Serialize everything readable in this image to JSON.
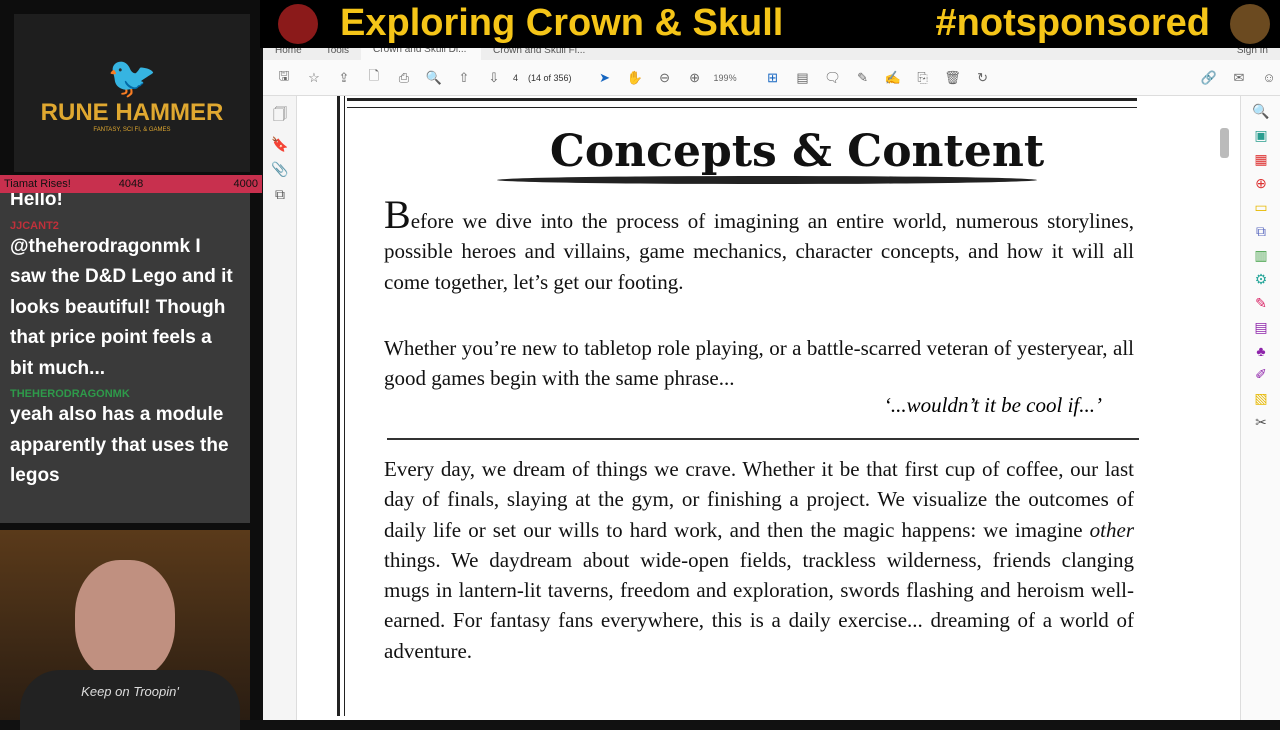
{
  "stream": {
    "title": "Exploring Crown & Skull",
    "tag": "#notsponsored",
    "logo_text": "RUNE HAMMER",
    "logo_sub": "FANTASY, SCI FI, & GAMES",
    "goal": {
      "label": "Tiamat Rises!",
      "current": "4048",
      "target": "4000"
    },
    "chat": [
      {
        "user": "",
        "text": "Hello!"
      },
      {
        "user": "JJCANT2",
        "user_color": "#c0303a",
        "text": "@theherodragonmk I saw the D&D Lego and it looks beautiful! Though that price point feels a bit much..."
      },
      {
        "user": "THEHERODRAGONMK",
        "user_color": "#2e9a4a",
        "text": "yeah also has a module apparently that uses the legos"
      }
    ],
    "webcam_shirt": "Keep on Troopin'"
  },
  "viewer": {
    "tabs": [
      "Home",
      "Tools",
      "Crown and Skull Di...",
      "Crown and Skull Fi..."
    ],
    "signin": "Sign In",
    "page_input": "4",
    "page_count": "(14 of 356)",
    "zoom": "199%",
    "toolbar_icons": [
      "save-icon",
      "star-icon",
      "upload-icon",
      "document-icon",
      "print-icon",
      "zoom-out-icon",
      "page-up-icon",
      "page-down-icon",
      "select-icon",
      "hand-icon",
      "minus-icon",
      "plus-icon",
      "fit-icon",
      "ruler-icon",
      "comment-icon",
      "pen-icon",
      "sign-icon",
      "stamp-icon",
      "trash-icon",
      "rotate-icon",
      "share-icon",
      "mail-icon",
      "user-icon"
    ]
  },
  "document": {
    "title": "Concepts & Content",
    "p1_dropcap": "B",
    "p1": "efore we dive into the process of imagining an entire world, numerous storylines, possible heroes and villains, game mechanics, character concepts, and how it will all come together, let’s get our footing.",
    "p2": "Whether you’re new to tabletop role playing, or a battle-scarred veteran of yesteryear, all good games begin with the same phrase...",
    "quote": "‘...wouldn’t it be cool if...’",
    "p3a": "Every day, we dream of things we crave. Whether it be that first cup of coffee, our last day of finals, slaying at the gym, or finishing a project. We visualize the outcomes of daily life or set our wills to hard work, and then the magic happens: we imagine ",
    "p3em": "other",
    "p3b": " things. We daydream about wide-open fields, trackless wilderness, friends clanging mugs in lantern-lit taverns, freedom and exploration, swords flashing and heroism well-earned. For fantasy fans everywhere, this is a daily exercise... dreaming of a world of adventure."
  }
}
